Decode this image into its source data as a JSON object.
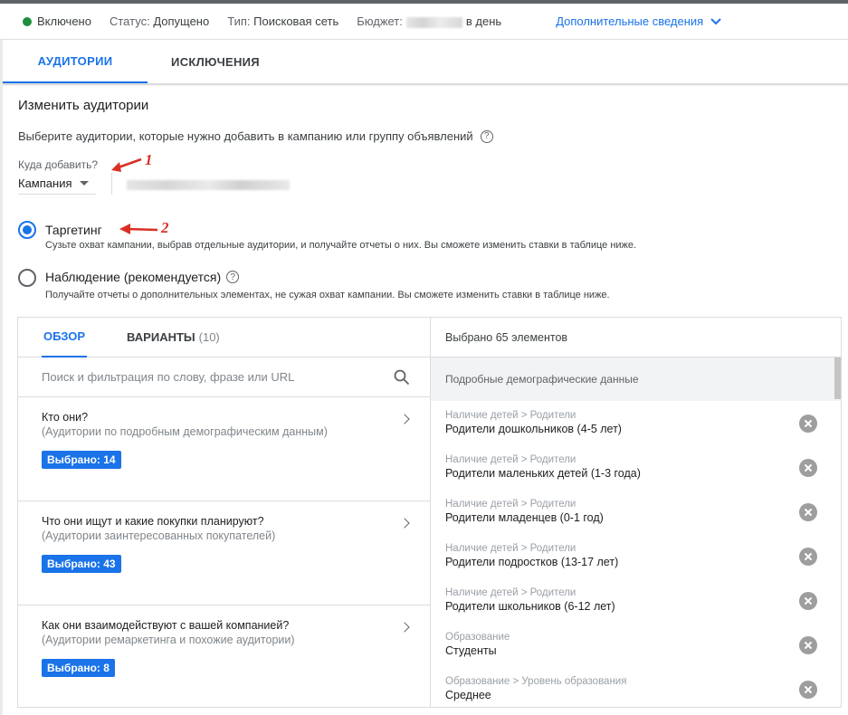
{
  "status_bar": {
    "status": "Включено",
    "status_label": "Статус:",
    "status_value": "Допущено",
    "type_label": "Тип:",
    "type_value": "Поисковая сеть",
    "budget_label": "Бюджет:",
    "budget_suffix": "в день",
    "more_label": "Дополнительные сведения",
    "status_color": "#1e8e3e"
  },
  "tabs": [
    "АУДИТОРИИ",
    "ИСКЛЮЧЕНИЯ"
  ],
  "section": {
    "title": "Изменить аудитории",
    "description": "Выберите аудитории, которые нужно добавить в кампанию или группу объявлений",
    "where_label": "Куда добавить?",
    "where_value": "Кампания"
  },
  "annotations": [
    "1",
    "2"
  ],
  "modes": [
    {
      "title": "Таргетинг",
      "description": "Сузьте охват кампании, выбрав отдельные аудитории, и получайте отчеты о них. Вы сможете изменить ставки в таблице ниже.",
      "selected": true
    },
    {
      "title": "Наблюдение (рекомендуется)",
      "description": "Получайте отчеты о дополнительных элементах, не сужая охват кампании. Вы сможете изменить ставки в таблице ниже.",
      "selected": false
    }
  ],
  "browse": {
    "tab_overview": "ОБЗОР",
    "tab_variants": "ВАРИАНТЫ",
    "variants_count": "(10)",
    "search_placeholder": "Поиск и фильтрация по слову, фразе или URL",
    "categories": [
      {
        "title": "Кто они?",
        "subtitle": "(Аудитории по подробным демографическим данным)",
        "badge": "Выбрано: 14"
      },
      {
        "title": "Что они ищут и какие покупки планируют?",
        "subtitle": "(Аудитории заинтересованных покупателей)",
        "badge": "Выбрано: 43"
      },
      {
        "title": "Как они взаимодействуют с вашей компанией?",
        "subtitle": "(Аудитории ремаркетинга и похожие аудитории)",
        "badge": "Выбрано: 8"
      }
    ]
  },
  "selected_panel": {
    "header": "Выбрано 65 элементов",
    "group": "Подробные демографические данные",
    "items": [
      {
        "path": "Наличие детей > Родители",
        "name": "Родители дошкольников (4-5 лет)"
      },
      {
        "path": "Наличие детей > Родители",
        "name": "Родители маленьких детей (1-3 года)"
      },
      {
        "path": "Наличие детей > Родители",
        "name": "Родители младенцев (0-1 год)"
      },
      {
        "path": "Наличие детей > Родители",
        "name": "Родители подростков (13-17 лет)"
      },
      {
        "path": "Наличие детей > Родители",
        "name": "Родители школьников (6-12 лет)"
      },
      {
        "path": "Образование",
        "name": "Студенты"
      },
      {
        "path": "Образование > Уровень образования",
        "name": "Среднее"
      }
    ]
  },
  "colors": {
    "accent": "#1a73e8",
    "annotation": "#d93025"
  }
}
